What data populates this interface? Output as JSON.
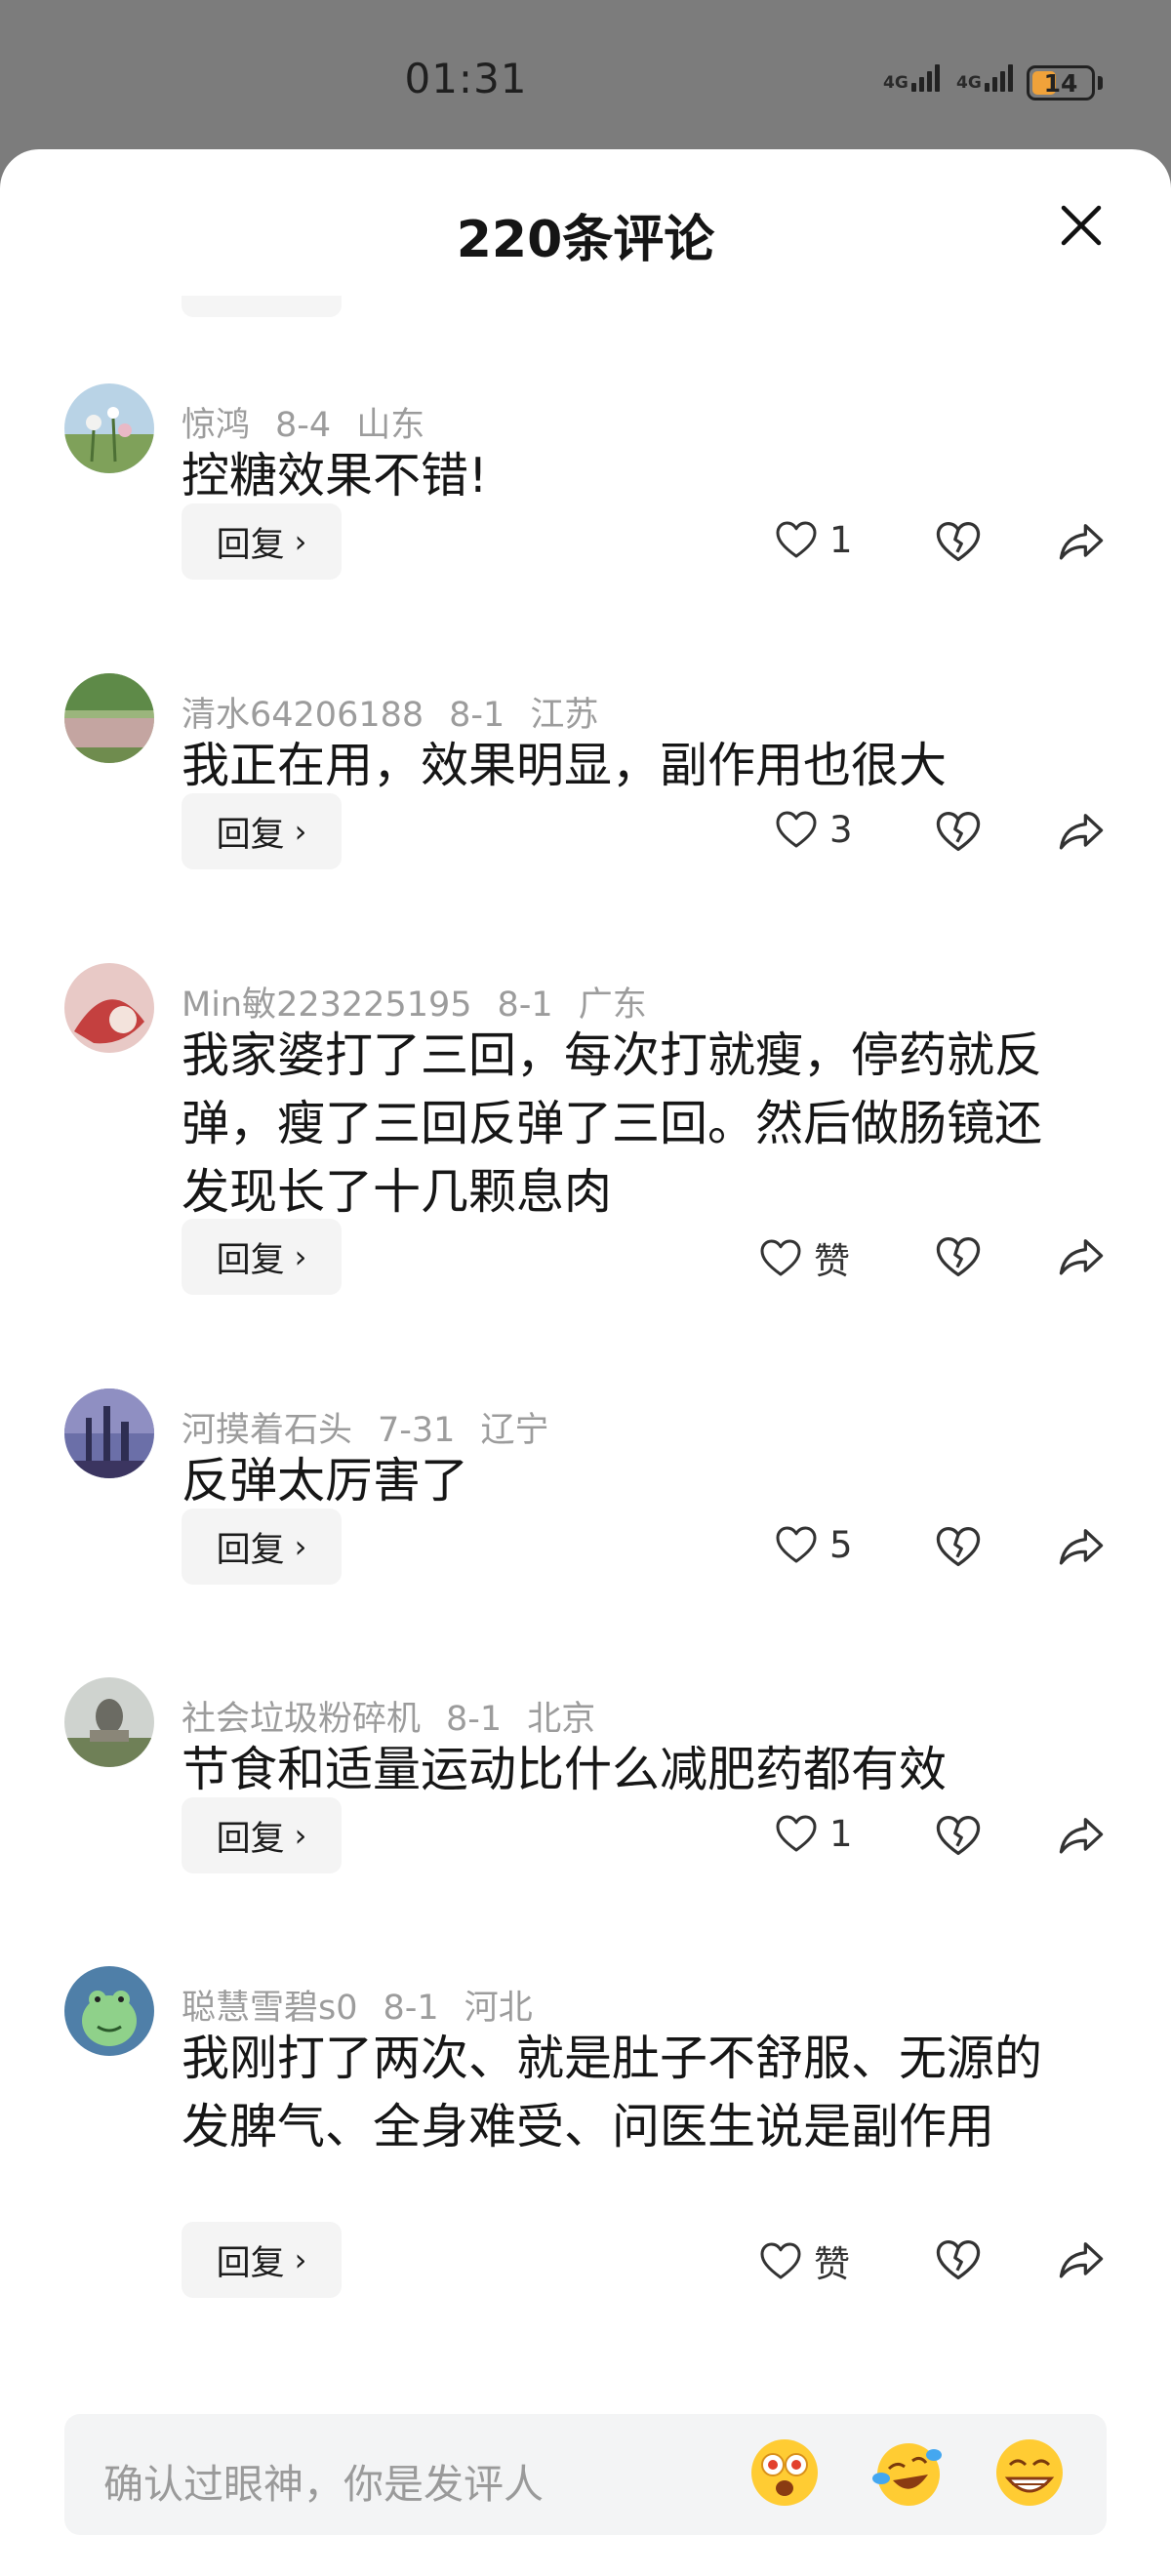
{
  "status": {
    "time": "01:31",
    "network_1": "4G",
    "network_2": "4G",
    "battery": "14"
  },
  "header": {
    "title": "220条评论"
  },
  "comments": [
    {
      "user": "惊鸿",
      "date": "8-4",
      "location": "山东",
      "text": "控糖效果不错!",
      "likes": "1",
      "reply_label": "回复"
    },
    {
      "user": "清水64206188",
      "date": "8-1",
      "location": "江苏",
      "text": "我正在用，效果明显，副作用也很大",
      "likes": "3",
      "reply_label": "回复"
    },
    {
      "user": "Min敏223225195",
      "date": "8-1",
      "location": "广东",
      "text": "我家婆打了三回，每次打就瘦，停药就反弹，瘦了三回反弹了三回。然后做肠镜还发现长了十几颗息肉",
      "likes": "赞",
      "reply_label": "回复"
    },
    {
      "user": "河摸着石头",
      "date": "7-31",
      "location": "辽宁",
      "text": "反弹太厉害了",
      "likes": "5",
      "reply_label": "回复"
    },
    {
      "user": "社会垃圾粉碎机",
      "date": "8-1",
      "location": "北京",
      "text": "节食和适量运动比什么减肥药都有效",
      "likes": "1",
      "reply_label": "回复"
    },
    {
      "user": "聪慧雪碧s0",
      "date": "8-1",
      "location": "河北",
      "text": "我刚打了两次、就是肚子不舒服、无源的发脾气、全身难受、问医生说是副作用",
      "likes": "赞",
      "reply_label": "回复"
    }
  ],
  "input": {
    "placeholder": "确认过眼神，你是发评人"
  },
  "icons": {
    "like": "heart-outline-icon",
    "dislike": "broken-heart-icon",
    "share": "share-arrow-icon",
    "close": "close-icon",
    "emojis": [
      "star-eyes-emoji",
      "crying-laughing-emoji",
      "grinning-emoji"
    ]
  },
  "colors": {
    "battery": "#f0a23a",
    "meta_text": "#9c9c9c",
    "reply_bg": "#f4f4f4",
    "input_bg": "#f3f4f5",
    "overlay": "#7c7c7c"
  }
}
